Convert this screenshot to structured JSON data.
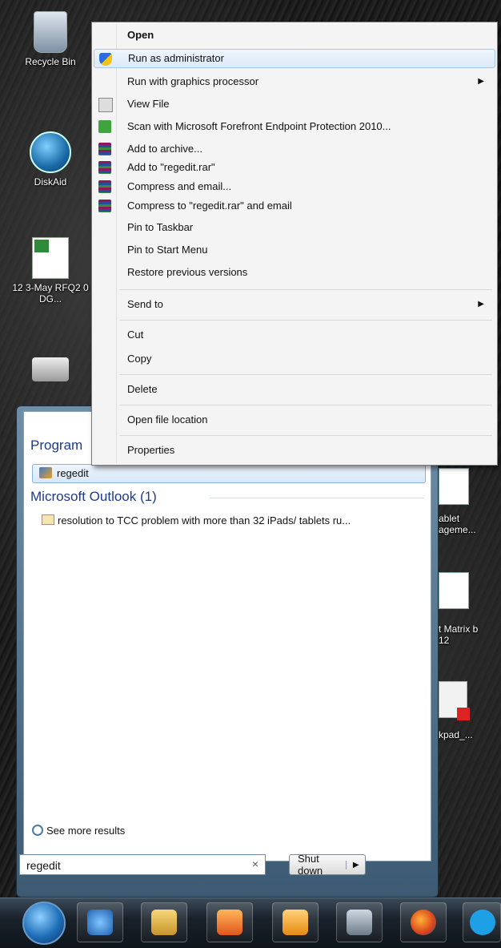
{
  "desktop": {
    "left_icons": [
      {
        "label": "Recycle Bin"
      },
      {
        "label": "DiskAid"
      },
      {
        "label": "12 3-May RFQ2 0 DG..."
      },
      {
        "label": ""
      }
    ],
    "right_icons": [
      {
        "label": "ablet ageme..."
      },
      {
        "label": "t Matrix b 12"
      },
      {
        "label": "kpad_..."
      }
    ]
  },
  "context_menu": {
    "items": [
      {
        "label": "Open",
        "bold": true,
        "icon": ""
      },
      {
        "label": "Run as administrator",
        "icon": "shield-icon"
      },
      {
        "label": "Run with graphics processor",
        "submenu": true,
        "icon": ""
      },
      {
        "label": "View File",
        "icon": "view-file-icon"
      },
      {
        "label": "Scan with Microsoft Forefront Endpoint Protection 2010...",
        "icon": "forefront-icon"
      },
      {
        "label": "Add to archive...",
        "icon": "winrar-icon"
      },
      {
        "label": "Add to \"regedit.rar\"",
        "icon": "winrar-icon"
      },
      {
        "label": "Compress and email...",
        "icon": "winrar-icon"
      },
      {
        "label": "Compress to \"regedit.rar\" and email",
        "icon": "winrar-icon"
      },
      {
        "label": "Pin to Taskbar",
        "icon": ""
      },
      {
        "label": "Pin to Start Menu",
        "icon": ""
      },
      {
        "label": "Restore previous versions",
        "icon": ""
      },
      {
        "label": "Send to",
        "submenu": true,
        "icon": ""
      },
      {
        "label": "Cut",
        "icon": ""
      },
      {
        "label": "Copy",
        "icon": ""
      },
      {
        "label": "Delete",
        "icon": ""
      },
      {
        "label": "Open file location",
        "icon": ""
      },
      {
        "label": "Properties",
        "icon": ""
      }
    ]
  },
  "start_menu": {
    "programs_header": "Program",
    "program_result": "regedit",
    "outlook_header": "Microsoft Outlook (1)",
    "outlook_result": "resolution to TCC problem with more than 32 iPads/ tablets ru...",
    "see_more": "See more results",
    "search_value": "regedit",
    "shutdown_label": "Shut down"
  },
  "taskbar": {
    "items": [
      "start-orb",
      "internet-explorer-icon",
      "file-explorer-icon",
      "media-player-icon",
      "outlook-icon",
      "tools-icon",
      "firefox-icon",
      "skype-icon"
    ]
  }
}
